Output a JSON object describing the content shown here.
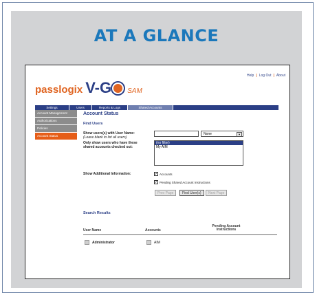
{
  "headline": "AT A GLANCE",
  "brand": {
    "pass": "passlogix",
    "vgo": "V-GO",
    "sam": "SAM"
  },
  "toplinks": [
    "Help",
    "Log Out",
    "About"
  ],
  "tabs": [
    "Settings",
    "Users",
    "Reports & Logs",
    "Shared Accounts"
  ],
  "sidebar": [
    "Account Management",
    "Authorizations",
    "Policies",
    "Account Status"
  ],
  "page_title": "Account Status",
  "find_users": "Find Users",
  "show_users_label": "Show users(s) with User Name:",
  "show_users_hint": "(Leave blank to list all users)",
  "filter_select": "None",
  "only_show_label": "Only show users who have these shared accounts checked out:",
  "list_options": [
    "(no filter)",
    "My AIM"
  ],
  "additional_label": "Show Additional Information:",
  "checks": [
    "Accounts",
    "Pending Shared Account Instructions"
  ],
  "buttons": {
    "prev": "Prev Page",
    "find": "Find User(s)",
    "next": "Next Page"
  },
  "results_title": "Search Results",
  "columns": [
    "User Name",
    "Accounts",
    "Pending Account Instructions"
  ],
  "row": {
    "user": "Administrator",
    "account": "AIM"
  }
}
